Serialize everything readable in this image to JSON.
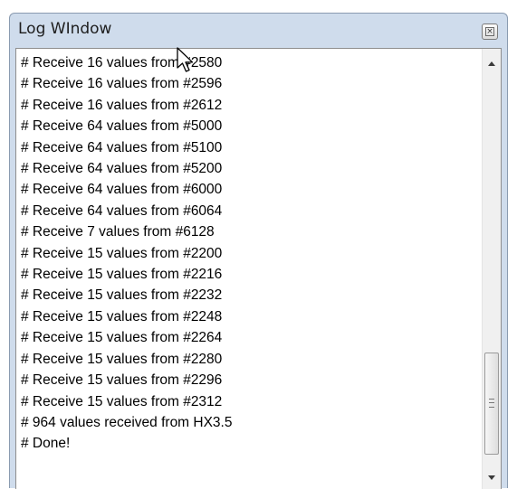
{
  "window": {
    "title": "Log WIndow",
    "close_glyph": "×"
  },
  "log": {
    "lines": [
      "# Receive 16 values from #2580",
      "# Receive 16 values from #2596",
      "# Receive 16 values from #2612",
      "# Receive 64 values from #5000",
      "# Receive 64 values from #5100",
      "# Receive 64 values from #5200",
      "# Receive 64 values from #6000",
      "# Receive 64 values from #6064",
      "# Receive 7 values from #6128",
      "# Receive 15 values from #2200",
      "# Receive 15 values from #2216",
      "# Receive 15 values from #2232",
      "# Receive 15 values from #2248",
      "# Receive 15 values from #2264",
      "# Receive 15 values from #2280",
      "# Receive 15 values from #2296",
      "# Receive 15 values from #2312",
      "# 964 values received from HX3.5",
      "# Done!"
    ]
  },
  "icons": {
    "close": "close-icon",
    "scroll_up": "chevron-up-icon",
    "scroll_down": "chevron-down-icon",
    "cursor": "mouse-pointer-icon"
  },
  "colors": {
    "frame": "#cfdcec",
    "log_background": "#ffffff",
    "text": "#000000"
  }
}
